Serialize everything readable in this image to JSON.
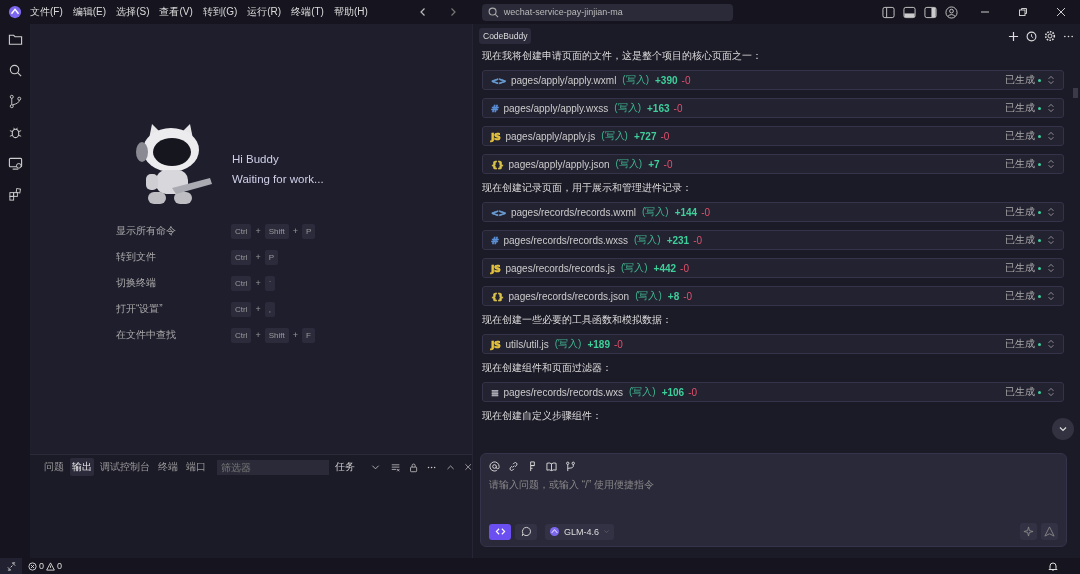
{
  "menu": [
    "文件(F)",
    "编辑(E)",
    "选择(S)",
    "查看(V)",
    "转到(G)",
    "运行(R)",
    "终端(T)",
    "帮助(H)"
  ],
  "search": {
    "value": "wechat-service-pay-jinjian-ma"
  },
  "welcome": {
    "title": "Hi Buddy",
    "subtitle": "Waiting for work...",
    "shortcuts": [
      {
        "label": "显示所有命令",
        "keys": [
          "Ctrl",
          "Shift",
          "P"
        ],
        "plus": "+"
      },
      {
        "label": "转到文件",
        "keys": [
          "Ctrl",
          "P"
        ],
        "plus": "+"
      },
      {
        "label": "切换终端",
        "keys": [
          "Ctrl",
          "`"
        ],
        "plus": "+"
      },
      {
        "label": "打开“设置”",
        "keys": [
          "Ctrl",
          ","
        ],
        "plus": "+"
      },
      {
        "label": "在文件中查找",
        "keys": [
          "Ctrl",
          "Shift",
          "F"
        ],
        "plus": "+"
      }
    ]
  },
  "panel": {
    "tabs": [
      {
        "label": "问题",
        "selected": false
      },
      {
        "label": "输出",
        "selected": true
      },
      {
        "label": "调试控制台",
        "selected": false
      },
      {
        "label": "终端",
        "selected": false
      },
      {
        "label": "端口",
        "selected": false
      }
    ],
    "filter": {
      "placeholder": "筛选器"
    },
    "dropdown": "任务"
  },
  "chat": {
    "tab": "CodeBuddy",
    "messages": [
      {
        "kind": "text",
        "text": "现在我将创建申请页面的文件，这是整个项目的核心页面之一："
      },
      {
        "kind": "file",
        "color": "#6aa0d8",
        "icon": "<>",
        "path": "pages/apply/apply.wxml",
        "action": "(写入)",
        "added": "+390",
        "removed": "-0",
        "status": "已生成"
      },
      {
        "kind": "file",
        "color": "#5b8fd6",
        "icon": "#",
        "path": "pages/apply/apply.wxss",
        "action": "(写入)",
        "added": "+163",
        "removed": "-0",
        "status": "已生成"
      },
      {
        "kind": "file",
        "color": "#e5c33c",
        "icon": "JS",
        "path": "pages/apply/apply.js",
        "action": "(写入)",
        "added": "+727",
        "removed": "-0",
        "status": "已生成"
      },
      {
        "kind": "file",
        "color": "#d9c34a",
        "icon": "{}",
        "path": "pages/apply/apply.json",
        "action": "(写入)",
        "added": "+7",
        "removed": "-0",
        "status": "已生成"
      },
      {
        "kind": "text",
        "text": "现在创建记录页面，用于展示和管理进件记录："
      },
      {
        "kind": "file",
        "color": "#6aa0d8",
        "icon": "<>",
        "path": "pages/records/records.wxml",
        "action": "(写入)",
        "added": "+144",
        "removed": "-0",
        "status": "已生成"
      },
      {
        "kind": "file",
        "color": "#5b8fd6",
        "icon": "#",
        "path": "pages/records/records.wxss",
        "action": "(写入)",
        "added": "+231",
        "removed": "-0",
        "status": "已生成"
      },
      {
        "kind": "file",
        "color": "#e5c33c",
        "icon": "JS",
        "path": "pages/records/records.js",
        "action": "(写入)",
        "added": "+442",
        "removed": "-0",
        "status": "已生成"
      },
      {
        "kind": "file",
        "color": "#d9c34a",
        "icon": "{}",
        "path": "pages/records/records.json",
        "action": "(写入)",
        "added": "+8",
        "removed": "-0",
        "status": "已生成"
      },
      {
        "kind": "text",
        "text": "现在创建一些必要的工具函数和模拟数据："
      },
      {
        "kind": "file",
        "color": "#e5c33c",
        "icon": "JS",
        "path": "utils/util.js",
        "action": "(写入)",
        "added": "+189",
        "removed": "-0",
        "status": "已生成"
      },
      {
        "kind": "text",
        "text": "现在创建组件和页面过滤器："
      },
      {
        "kind": "file",
        "color": "#b8b8c0",
        "icon": "≡",
        "path": "pages/records/records.wxs",
        "action": "(写入)",
        "added": "+106",
        "removed": "-0",
        "status": "已生成"
      },
      {
        "kind": "text",
        "text": "现在创建自定义步骤组件："
      }
    ],
    "input": {
      "placeholder": "请输入问题，或输入 “/” 使用便捷指令",
      "mode_code": {
        "selected": true
      },
      "mode_chat": {
        "selected": false
      },
      "model": "GLM-4.6"
    }
  },
  "status": {
    "errors": "0",
    "warnings": "0"
  }
}
